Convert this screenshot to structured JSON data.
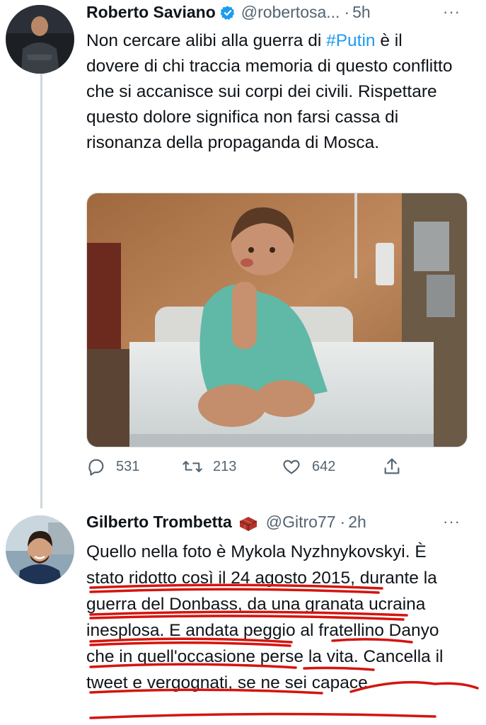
{
  "tweet1": {
    "author_name": "Roberto Saviano",
    "verified_icon": "verified-badge-icon",
    "handle": "@robertosa...",
    "separator": "·",
    "time": "5h",
    "more_label": "···",
    "text_pre": "Non cercare alibi alla guerra di ",
    "hashtag": "#Putin",
    "text_post": " è il dovere di chi traccia memoria di questo conflitto che si accanisce sui corpi dei civili. Rispettare questo dolore significa non farsi cassa di risonanza della propaganda di Mosca.",
    "media_icon": "photo-child-hospital-bed",
    "actions": {
      "reply_count": "531",
      "retweet_count": "213",
      "like_count": "642"
    }
  },
  "tweet2": {
    "author_name": "Gilberto Trombetta",
    "name_emoji_icon": "bricks-icon",
    "handle": "@Gitro77",
    "separator": "·",
    "time": "2h",
    "more_label": "···",
    "text": "Quello nella foto è Mykola Nyzhnykovskyi. È stato ridotto così il 24 agosto 2015, durante la guerra del Donbass, da una granata ucraina inesplosa. E andata peggio al fratellino Danyo che in quell'occasione perse la vita. Cancella il tweet e vergognati, se ne sei capace",
    "annotation_color": "#d4150f"
  },
  "colors": {
    "link": "#1d9bf0",
    "verified": "#1d9bf0",
    "muted": "#536471",
    "text": "#0f1419"
  }
}
